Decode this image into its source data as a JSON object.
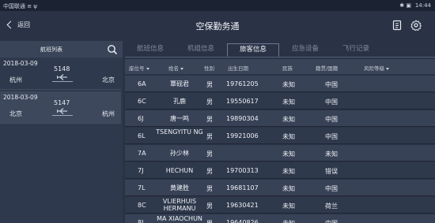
{
  "status_bar": {
    "carrier": "中国联通 ≡ ψ",
    "system": "✱ ▣",
    "time": "14:44"
  },
  "header": {
    "back_label": "返回",
    "title": "空保勤务通"
  },
  "flight_list": {
    "title": "航班列表",
    "items": [
      {
        "date": "2018-03-09",
        "flight_no": "5148",
        "from": "杭州",
        "to": "北京"
      },
      {
        "date": "2018-03-09",
        "flight_no": "5147",
        "from": "北京",
        "to": "杭州"
      }
    ]
  },
  "tabs": [
    "航班信息",
    "机组信息",
    "旅客信息",
    "应急设备",
    "飞行记录"
  ],
  "active_tab": 2,
  "table": {
    "columns": [
      "座位号",
      "姓名",
      "性别",
      "出生日期",
      "民族",
      "籍贯/国籍",
      "风险等级"
    ],
    "rows": [
      {
        "seat": "6A",
        "name": "覃砚君",
        "gender": "男",
        "dob": "19761205",
        "ethnicity": "未知",
        "nationality": "中国",
        "risk": ""
      },
      {
        "seat": "6C",
        "name": "孔鹿",
        "gender": "男",
        "dob": "19550617",
        "ethnicity": "未知",
        "nationality": "中国",
        "risk": ""
      },
      {
        "seat": "6J",
        "name": "唐一鸣",
        "gender": "男",
        "dob": "19890304",
        "ethnicity": "未知",
        "nationality": "中国",
        "risk": ""
      },
      {
        "seat": "6L",
        "name": "TSENGYITU NG",
        "gender": "男",
        "dob": "19921006",
        "ethnicity": "未知",
        "nationality": "中国",
        "risk": ""
      },
      {
        "seat": "7A",
        "name": "孙少林",
        "gender": "男",
        "dob": "",
        "ethnicity": "未知",
        "nationality": "未知",
        "risk": ""
      },
      {
        "seat": "7J",
        "name": "HECHUN",
        "gender": "男",
        "dob": "19700313",
        "ethnicity": "未知",
        "nationality": "错误",
        "risk": ""
      },
      {
        "seat": "7L",
        "name": "黄建胜",
        "gender": "男",
        "dob": "19681107",
        "ethnicity": "未知",
        "nationality": "中国",
        "risk": ""
      },
      {
        "seat": "8C",
        "name": "VLIERHUIS HERMANU",
        "gender": "男",
        "dob": "19630421",
        "ethnicity": "未知",
        "nationality": "荷兰",
        "risk": ""
      },
      {
        "seat": "8J",
        "name": "MA XIAOCHUN",
        "gender": "男",
        "dob": "19640826",
        "ethnicity": "未知",
        "nationality": "中国",
        "risk": ""
      }
    ]
  },
  "colors": {
    "background": "#2a3346",
    "panel": "#2f394d",
    "header_row": "#3a4458",
    "row_odd": "#384257",
    "row_even": "#2f394c"
  }
}
